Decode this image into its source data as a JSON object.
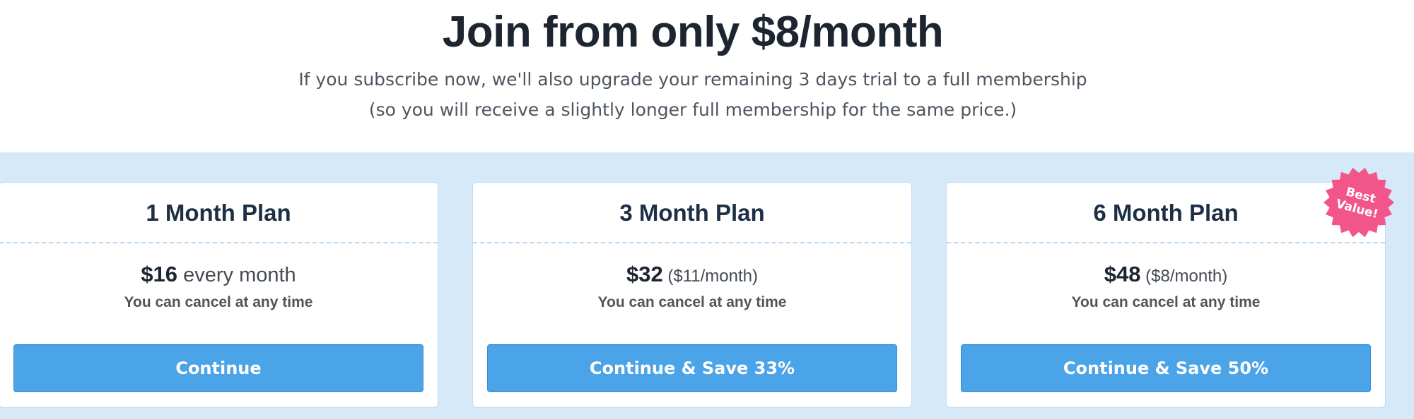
{
  "header": {
    "headline": "Join from only $8/month",
    "subtitle_line1": "If you subscribe now, we'll also upgrade your remaining 3 days trial to a full membership",
    "subtitle_line2": "(so you will receive a slightly longer full membership for the same price.)"
  },
  "plans": [
    {
      "title": "1 Month Plan",
      "price": "$16",
      "price_extra": " every month",
      "note": "You can cancel at any time",
      "button": "Continue"
    },
    {
      "title": "3 Month Plan",
      "price": "$32",
      "price_extra": " ($11/month)",
      "note": "You can cancel at any time",
      "button": "Continue & Save 33%"
    },
    {
      "title": "6 Month Plan",
      "price": "$48",
      "price_extra": " ($8/month)",
      "note": "You can cancel at any time",
      "button": "Continue & Save 50%"
    }
  ],
  "badge": {
    "line1": "Best",
    "line2": "Value!",
    "color": "#f2558a",
    "icon": "starburst-badge-icon"
  },
  "colors": {
    "accent": "#4ba3e8",
    "band": "#d6e9f9",
    "heading": "#1c2f44"
  }
}
